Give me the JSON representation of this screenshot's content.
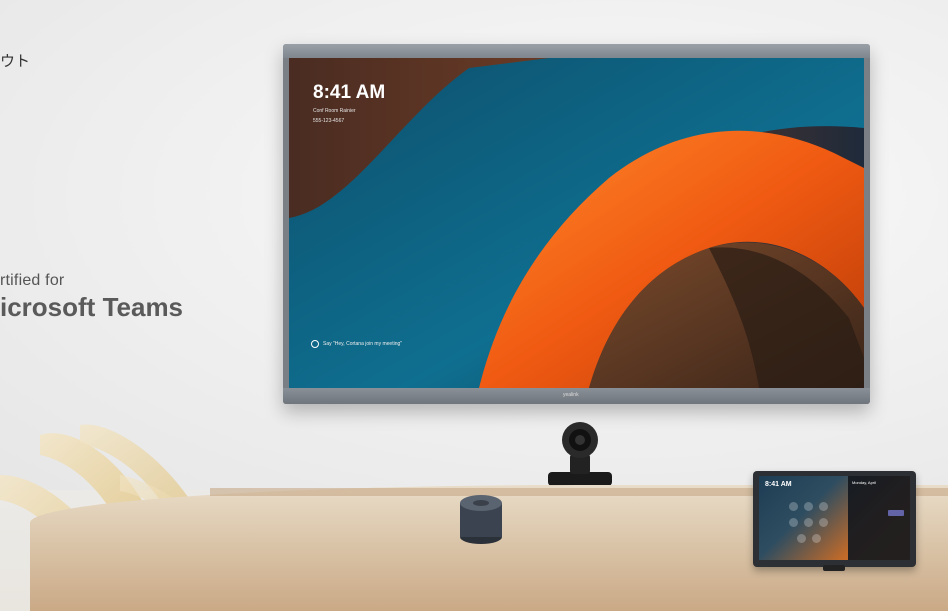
{
  "headline_fragment": "ウト",
  "certification": {
    "line1": "rtified for",
    "line2": "icrosoft Teams"
  },
  "display": {
    "time": "8:41 AM",
    "room": "Conf Room Rainier",
    "phone": "555-123-4567",
    "cortana_prompt": "Say \"Hey, Cortana join my meeting\"",
    "brand": "yealink"
  },
  "tablet": {
    "time": "8:41 AM",
    "side_title": "Monday, April"
  },
  "colors": {
    "wave_orange": "#f06a1a",
    "wave_teal": "#0f5f7e",
    "wave_brown": "#5a3624",
    "teams_purple": "#6264a7"
  }
}
